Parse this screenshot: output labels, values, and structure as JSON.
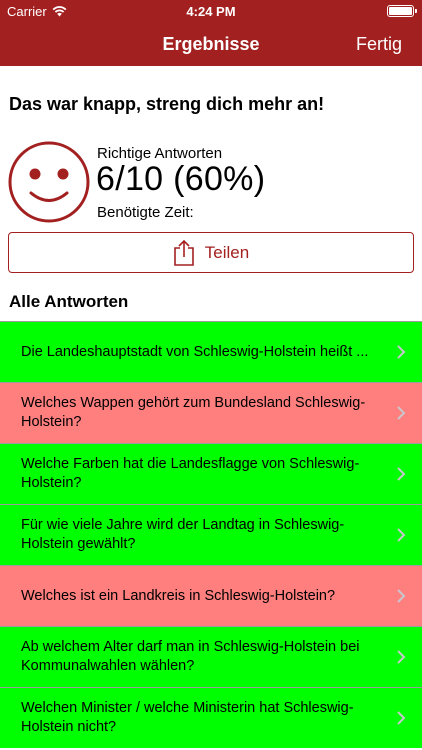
{
  "status_bar": {
    "carrier": "Carrier",
    "time": "4:24 PM",
    "battery_level": 1.0
  },
  "nav": {
    "title": "Ergebnisse",
    "done_label": "Fertig"
  },
  "result": {
    "headline": "Das war knapp, streng dich mehr an!",
    "score_label": "Richtige Antworten",
    "score_value": "6/10 (60%)",
    "time_label": "Benötigte Zeit:",
    "mood_icon": "smiley-face-icon"
  },
  "share": {
    "label": "Teilen",
    "icon": "share-icon"
  },
  "answers_section": {
    "title": "Alle Antworten"
  },
  "answers": [
    {
      "question": "Die Landeshauptstadt von Schleswig-Holstein heißt ...",
      "status": "correct"
    },
    {
      "question": "Welches Wappen gehört zum Bundesland Schleswig-Holstein?",
      "status": "wrong"
    },
    {
      "question": "Welche Farben hat die Landesflagge von Schleswig-Holstein?",
      "status": "correct"
    },
    {
      "question": "Für wie viele Jahre wird der Landtag in Schleswig-Holstein gewählt?",
      "status": "correct"
    },
    {
      "question": "Welches ist ein Landkreis in Schleswig-Holstein?",
      "status": "wrong"
    },
    {
      "question": "Ab welchem Alter darf man in Schleswig-Holstein bei Kommunalwahlen wählen?",
      "status": "correct"
    },
    {
      "question": "Welchen Minister / welche Ministerin hat Schleswig-Holstein nicht?",
      "status": "correct"
    }
  ],
  "colors": {
    "brand": "#a32020",
    "correct": "#00ff00",
    "wrong": "#ff7f7f"
  }
}
